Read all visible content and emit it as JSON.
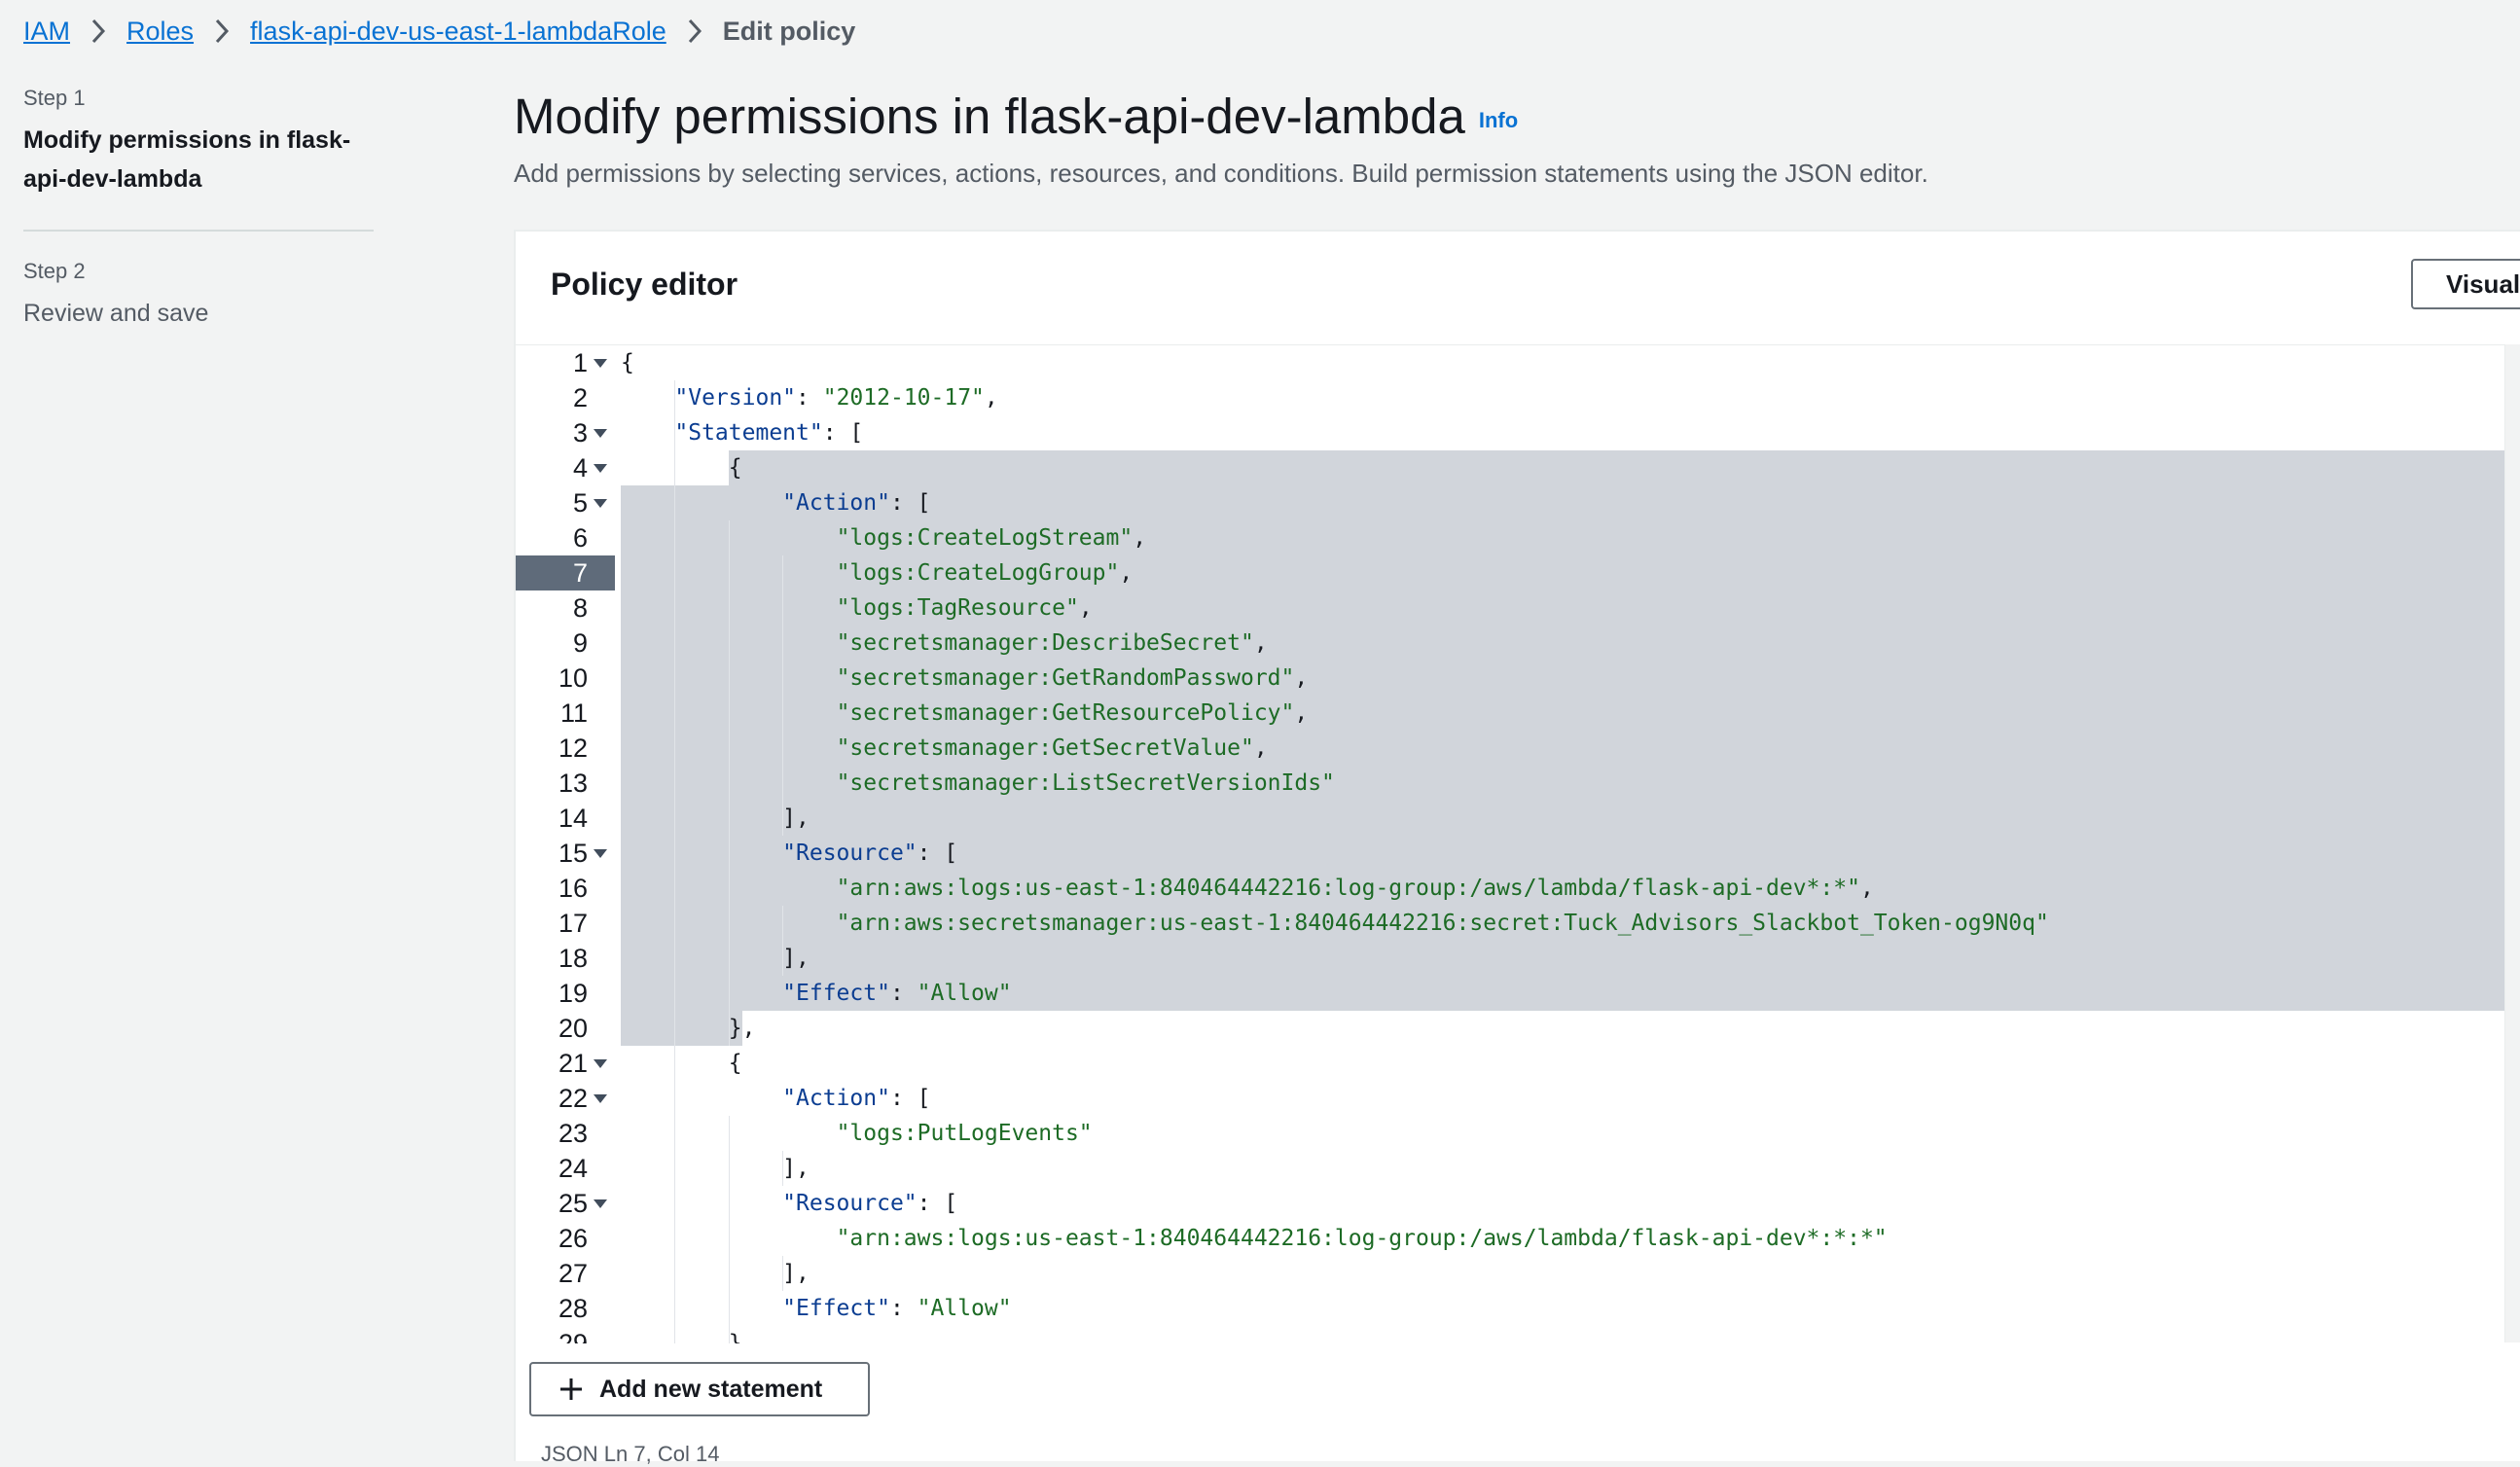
{
  "breadcrumb": {
    "items": [
      "IAM",
      "Roles",
      "flask-api-dev-us-east-1-lambdaRole"
    ],
    "current": "Edit policy"
  },
  "steps": {
    "step1_num": "Step 1",
    "step1_title": "Modify permissions in flask-api-dev-lambda",
    "step2_num": "Step 2",
    "step2_title": "Review and save"
  },
  "page": {
    "title": "Modify permissions in flask-api-dev-lambda",
    "info": "Info",
    "description": "Add permissions by selecting services, actions, resources, and conditions. Build permission statements using the JSON editor."
  },
  "editor": {
    "header": "Policy editor",
    "visual_button": "Visual",
    "active_line": 7,
    "lines": [
      "{",
      "    \"Version\": \"2012-10-17\",",
      "    \"Statement\": [",
      "        {",
      "            \"Action\": [",
      "                \"logs:CreateLogStream\",",
      "                \"logs:CreateLogGroup\",",
      "                \"logs:TagResource\",",
      "                \"secretsmanager:DescribeSecret\",",
      "                \"secretsmanager:GetRandomPassword\",",
      "                \"secretsmanager:GetResourcePolicy\",",
      "                \"secretsmanager:GetSecretValue\",",
      "                \"secretsmanager:ListSecretVersionIds\"",
      "            ],",
      "            \"Resource\": [",
      "                \"arn:aws:logs:us-east-1:840464442216:log-group:/aws/lambda/flask-api-dev*:*\",",
      "                \"arn:aws:secretsmanager:us-east-1:840464442216:secret:Tuck_Advisors_Slackbot_Token-og9N0q\"",
      "            ],",
      "            \"Effect\": \"Allow\"",
      "        },",
      "        {",
      "            \"Action\": [",
      "                \"logs:PutLogEvents\"",
      "            ],",
      "            \"Resource\": [",
      "                \"arn:aws:logs:us-east-1:840464442216:log-group:/aws/lambda/flask-api-dev*:*:*\"",
      "            ],",
      "            \"Effect\": \"Allow\"",
      "        }"
    ],
    "fold_lines": [
      1,
      3,
      4,
      5,
      15,
      21,
      22,
      25
    ]
  },
  "footer": {
    "add_statement": "Add new statement",
    "status": "JSON   Ln 7, Col 14"
  }
}
